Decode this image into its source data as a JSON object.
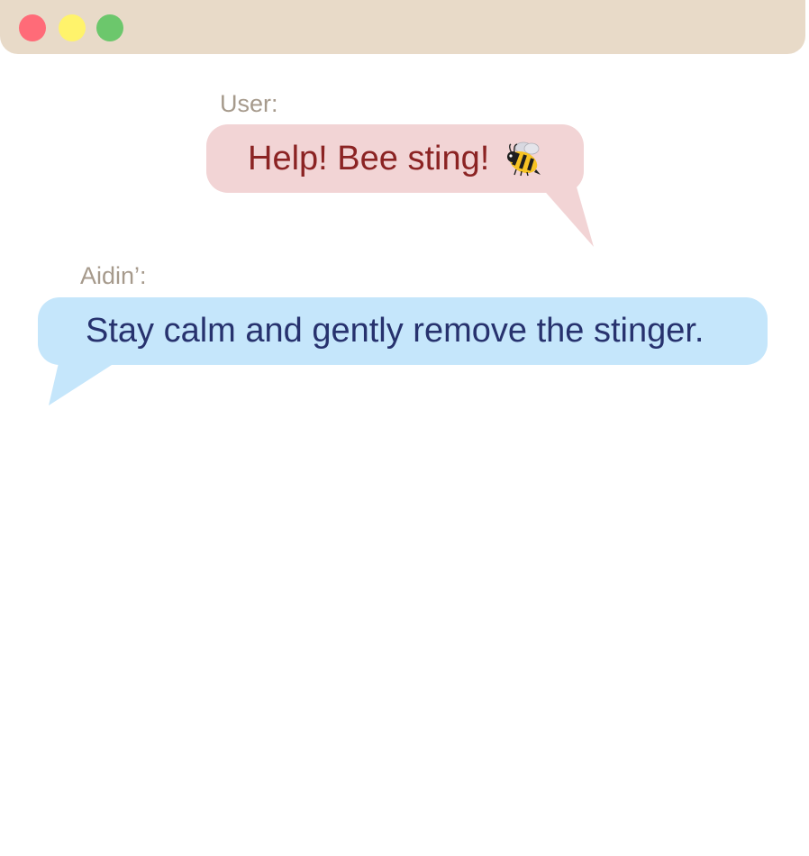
{
  "window": {
    "controls": [
      "close",
      "minimize",
      "maximize"
    ],
    "colors": {
      "titlebar": "#e8dac8",
      "close": "#ff6b78",
      "minimize": "#fff36b",
      "maximize": "#6cc76c"
    }
  },
  "messages": [
    {
      "speaker": "User:",
      "text": "Help! Bee sting!",
      "icon": "bee-icon",
      "bubble_color": "#f2d4d5",
      "text_color": "#8b2323"
    },
    {
      "speaker": "Aidin’:",
      "text": "Stay calm and gently remove the stinger.",
      "bubble_color": "#c5e6fb",
      "text_color": "#27326e"
    }
  ]
}
